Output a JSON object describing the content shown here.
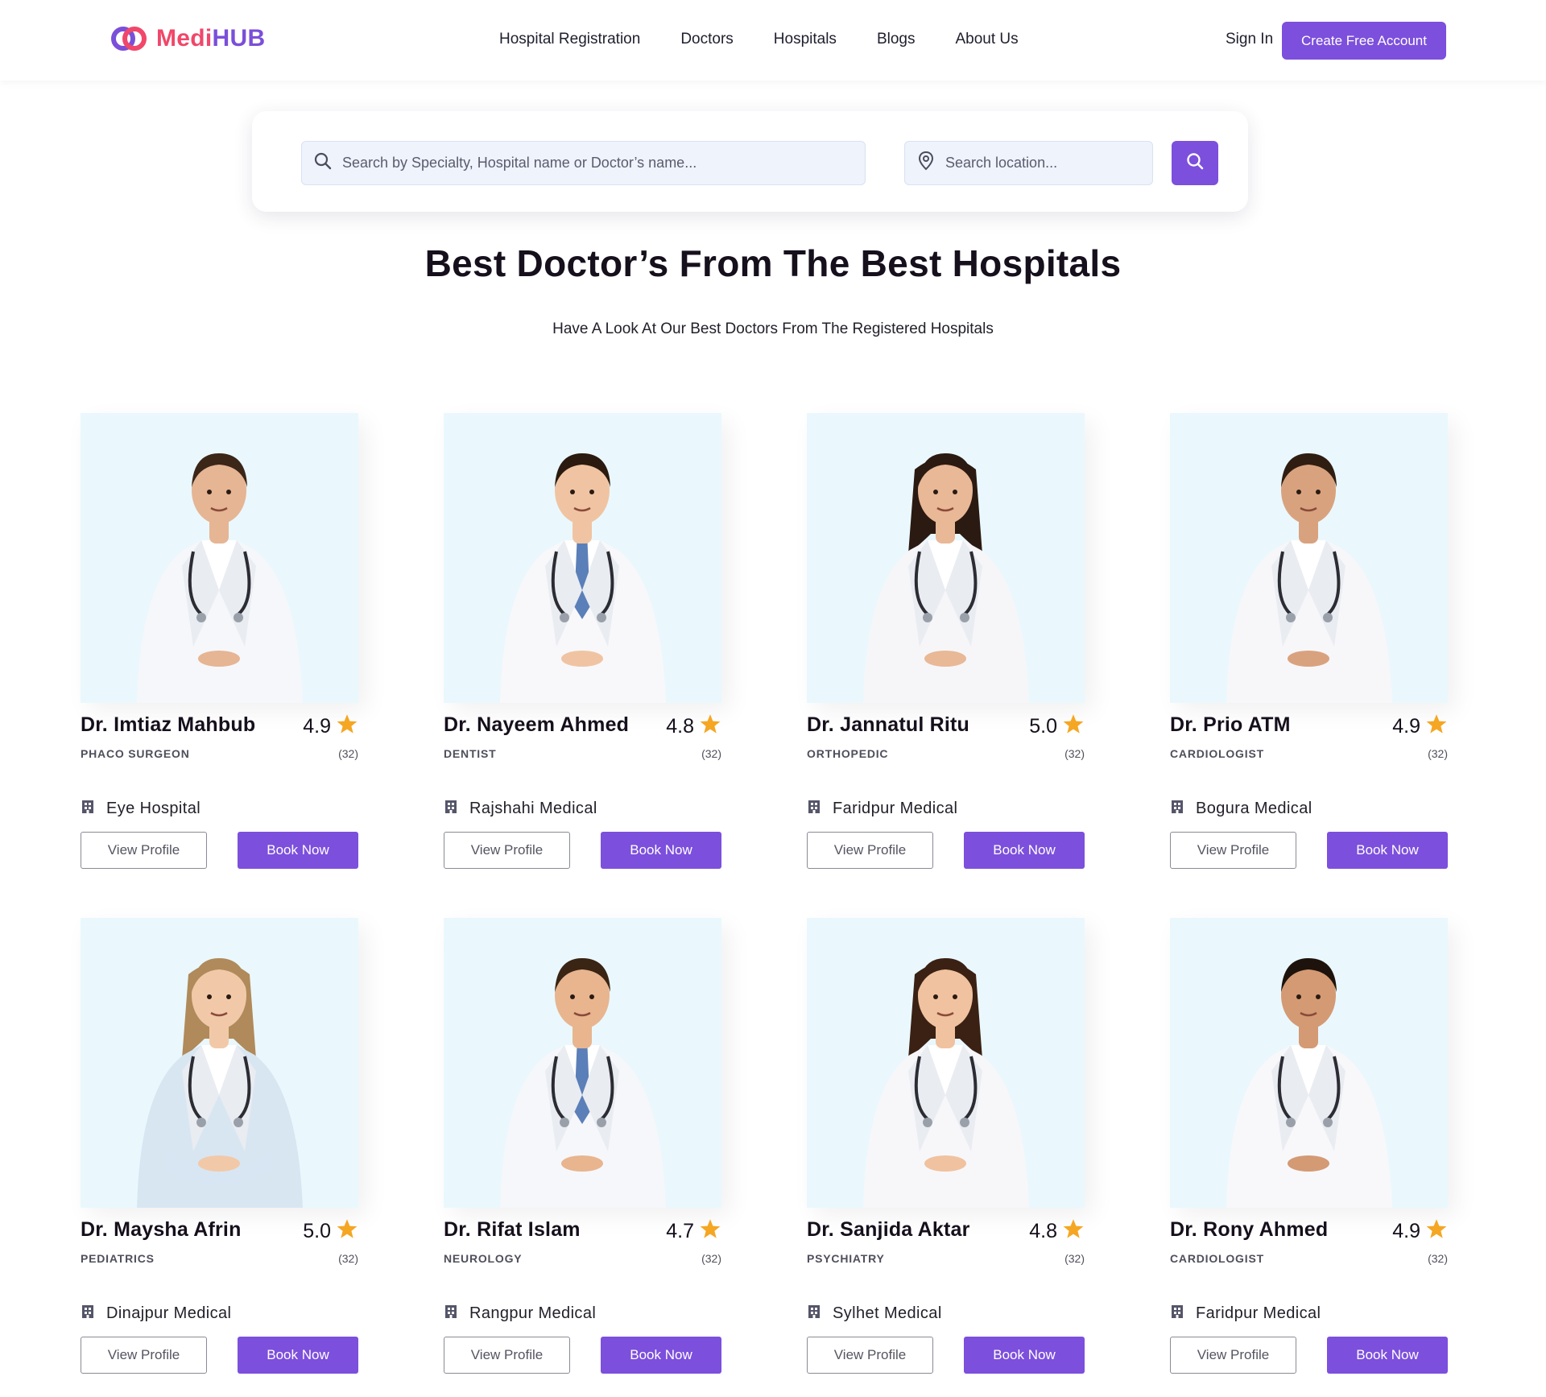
{
  "brand": {
    "part1": "Medi",
    "part2": "HUB",
    "primary_color": "#7c4fdc",
    "accent_color": "#f0476a"
  },
  "nav": {
    "items": [
      "Hospital Registration",
      "Doctors",
      "Hospitals",
      "Blogs",
      "About Us"
    ],
    "sign_in": "Sign In",
    "cta": "Create Free Account"
  },
  "search": {
    "query_placeholder": "Search by Specialty, Hospital name or Doctor’s name...",
    "location_placeholder": "Search location...",
    "icons": {
      "query": "search-icon",
      "location": "location-pin-icon",
      "submit": "search-icon"
    }
  },
  "section": {
    "title": "Best Doctor’s From The Best Hospitals",
    "subtitle": "Have A Look At Our Best Doctors From The Registered Hospitals"
  },
  "buttons": {
    "view_profile": "View Profile",
    "book_now": "Book Now"
  },
  "doctors": [
    {
      "name": "Dr. Imtiaz Mahbub",
      "rating": "4.9",
      "specialty": "Phaco Surgeon",
      "reviews": "(32)",
      "hospital": "Eye Hospital"
    },
    {
      "name": "Dr. Nayeem Ahmed",
      "rating": "4.8",
      "specialty": "Dentist",
      "reviews": "(32)",
      "hospital": "Rajshahi Medical"
    },
    {
      "name": "Dr. Jannatul Ritu",
      "rating": "5.0",
      "specialty": "Orthopedic",
      "reviews": "(32)",
      "hospital": "Faridpur Medical"
    },
    {
      "name": "Dr. Prio ATM",
      "rating": "4.9",
      "specialty": "Cardiologist",
      "reviews": "(32)",
      "hospital": "Bogura Medical"
    },
    {
      "name": "Dr. Maysha Afrin",
      "rating": "5.0",
      "specialty": "Pediatrics",
      "reviews": "(32)",
      "hospital": "Dinajpur Medical"
    },
    {
      "name": "Dr. Rifat Islam",
      "rating": "4.7",
      "specialty": "Neurology",
      "reviews": "(32)",
      "hospital": "Rangpur Medical"
    },
    {
      "name": "Dr. Sanjida Aktar",
      "rating": "4.8",
      "specialty": "Psychiatry",
      "reviews": "(32)",
      "hospital": "Sylhet Medical"
    },
    {
      "name": "Dr. Rony Ahmed",
      "rating": "4.9",
      "specialty": "Cardiologist",
      "reviews": "(32)",
      "hospital": "Faridpur Medical"
    }
  ]
}
